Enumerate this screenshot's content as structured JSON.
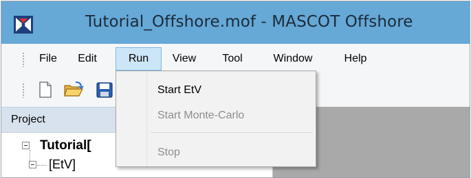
{
  "window": {
    "title": "Tutorial_Offshore.mof - MASCOT Offshore",
    "app_icon": "mascot-logo-icon",
    "titlebar_color": "#66a8d6"
  },
  "menubar": {
    "items": [
      {
        "label": "File"
      },
      {
        "label": "Edit"
      },
      {
        "label": "Run",
        "active": true
      },
      {
        "label": "View"
      },
      {
        "label": "Tool"
      },
      {
        "label": "Window"
      },
      {
        "label": "Help"
      }
    ],
    "active_highlight": "#cde6f7"
  },
  "toolbar": {
    "buttons": [
      {
        "icon": "new-document-icon"
      },
      {
        "icon": "open-folder-icon"
      },
      {
        "icon": "save-disk-icon"
      }
    ]
  },
  "run_menu": {
    "items": [
      {
        "label": "Start EtV",
        "enabled": true
      },
      {
        "label": "Start Monte-Carlo",
        "enabled": false
      },
      {
        "label": "Stop",
        "enabled": false
      }
    ]
  },
  "project": {
    "title": "Project",
    "tree": {
      "root": "Tutorial[",
      "children": [
        "[EtV]"
      ]
    }
  }
}
